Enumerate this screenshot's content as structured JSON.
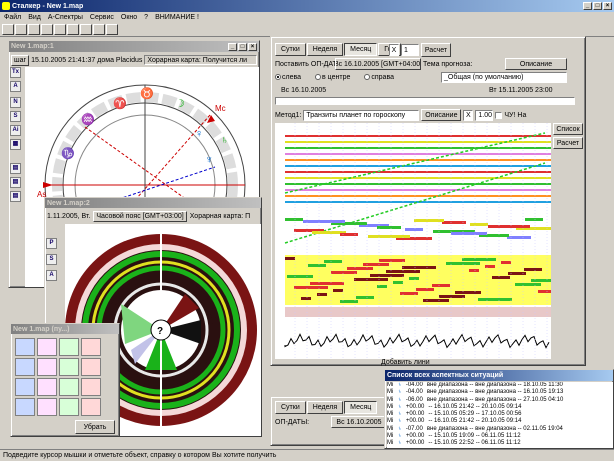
{
  "app": {
    "title": "Сталкер - New 1.map",
    "status": "Подведите курсор мышки и отметьте объект, справку о котором Вы хотите получить"
  },
  "menu": [
    "Файл",
    "Вид",
    "А-Спектры",
    "Сервис",
    "Окно",
    "?",
    "ВНИМАНИЕ !"
  ],
  "map1": {
    "title": "New 1.map:1",
    "step": "шаг",
    "date": "15.10.2005 21:41:37",
    "house": "дома Placidus",
    "horary": "Хорарная карта: Получится ли"
  },
  "map2": {
    "title": "New 1.map:2",
    "date": "1.11.2005, Вт.",
    "tz": "Часовой пояс [GMT+03:00]",
    "horary": "Хорарная карта: П",
    "center": "?"
  },
  "palette": {
    "title": "New 1.map (пу...)",
    "remove": "Убрать"
  },
  "forecast": {
    "tabs": [
      "Сутки",
      "Неделя",
      "Месяц",
      "Год"
    ],
    "active_tab": "Месяц",
    "mult": "1",
    "calc": "Расчет",
    "place_label": "Поставить ОП-ДАТЫ:",
    "date_btn": "Вс 16.10.2005 [GMT+04:00]",
    "theme_label": "Тема прогноза:",
    "desc": "Описание",
    "radios": [
      "слева",
      "в центре",
      "справа"
    ],
    "theme_value": "_Общая (по умолчанию)",
    "start": "Вс 16.10.2005",
    "end": "Вт 15.11.2005 23:00",
    "method_label": "Метод1:",
    "method": "Транзиты планет по гороскопу",
    "method_desc": "Описание",
    "scale": "1.00",
    "chu": "ЧУ!",
    "na": "На",
    "list_btn": "Список",
    "calc2": "Расчет",
    "add": "Добавить лини"
  },
  "forecast2": {
    "tabs": [
      "Сутки",
      "Неделя",
      "Месяц"
    ],
    "date_label": "ОП-ДАТЫ:",
    "date_btn": "Вс 16.10.2005"
  },
  "aspects": {
    "title": "Список всех аспектных ситуаций",
    "rows": [
      {
        "code": "Mi",
        "val": "-04.00",
        "text": "вне диапазона -- вне диапазона -- 18.10.05 11:30"
      },
      {
        "code": "Mi",
        "val": "-04.00",
        "text": "вне диапазона -- вне диапазона -- 16.10.05 19:13"
      },
      {
        "code": "Mi",
        "val": "-06.00",
        "text": "вне диапазона -- вне диапазона -- 27.10.05 04:10"
      },
      {
        "code": "Mi",
        "val": "+00.00",
        "text": "-- 16.10.05 21:42 -- 20.10.05 09:14"
      },
      {
        "code": "Mi",
        "val": "+00.00",
        "text": "-- 15.10.05 05:29 -- 17.10.05 00:56"
      },
      {
        "code": "Mi",
        "val": "+00.00",
        "text": "-- 16.10.05 21:42 -- 20.10.05 09:14"
      },
      {
        "code": "Mi",
        "val": "-07.00",
        "text": "вне диапазона -- вне диапазона -- 02.11.05 19:04"
      },
      {
        "code": "Mi",
        "val": "+00.00",
        "text": "-- 15.10.05 19:09 -- 06.11.05 11:12"
      },
      {
        "code": "Mi",
        "val": "+00.00",
        "text": "-- 15.10.05 22:52 -- 06.11.05 11:12"
      }
    ]
  },
  "colors": {
    "title": "#0a246a",
    "ring_dark": "#7a1414",
    "green": "#22cc22"
  }
}
